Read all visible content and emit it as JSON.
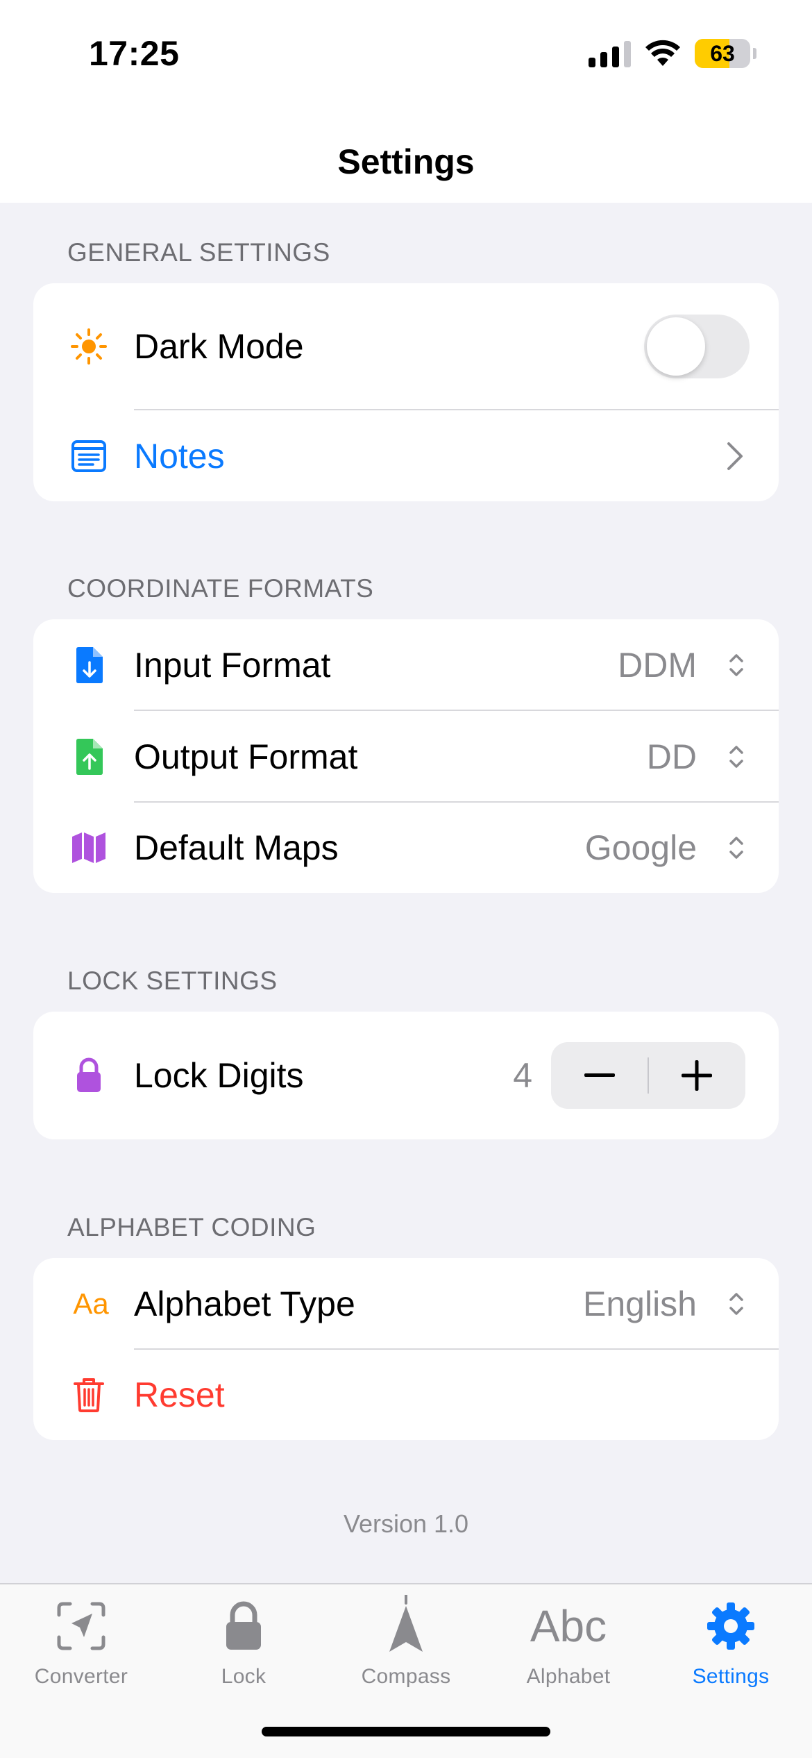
{
  "status_bar": {
    "time": "17:25",
    "battery": "63",
    "battery_level": 0.63
  },
  "header": {
    "title": "Settings"
  },
  "sections": {
    "general": {
      "title": "GENERAL SETTINGS",
      "dark_mode": {
        "label": "Dark Mode",
        "enabled": false,
        "icon": "sun-icon"
      },
      "notes": {
        "label": "Notes",
        "icon": "notes-icon"
      }
    },
    "coordinates": {
      "title": "COORDINATE FORMATS",
      "input": {
        "label": "Input Format",
        "value": "DDM",
        "icon": "file-download-icon"
      },
      "output": {
        "label": "Output Format",
        "value": "DD",
        "icon": "file-upload-icon"
      },
      "maps": {
        "label": "Default Maps",
        "value": "Google",
        "icon": "map-icon"
      }
    },
    "lock": {
      "title": "LOCK SETTINGS",
      "digits": {
        "label": "Lock Digits",
        "value": "4",
        "icon": "lock-icon"
      }
    },
    "alphabet": {
      "title": "ALPHABET CODING",
      "type": {
        "label": "Alphabet Type",
        "value": "English",
        "icon_text": "Aa"
      },
      "reset": {
        "label": "Reset",
        "icon": "trash-icon"
      }
    }
  },
  "version": "Version 1.0",
  "tabs": [
    {
      "label": "Converter",
      "icon": "converter-icon"
    },
    {
      "label": "Lock",
      "icon": "lock-icon"
    },
    {
      "label": "Compass",
      "icon": "compass-icon"
    },
    {
      "label": "Alphabet",
      "icon_text": "Abc"
    },
    {
      "label": "Settings",
      "icon": "gear-icon"
    }
  ],
  "colors": {
    "accent": "#0a7aff",
    "orange": "#ff9500",
    "green": "#34c759",
    "purple": "#af52de",
    "red": "#ff3b30",
    "secondary_text": "#8a8a8e",
    "background": "#f2f2f7"
  }
}
